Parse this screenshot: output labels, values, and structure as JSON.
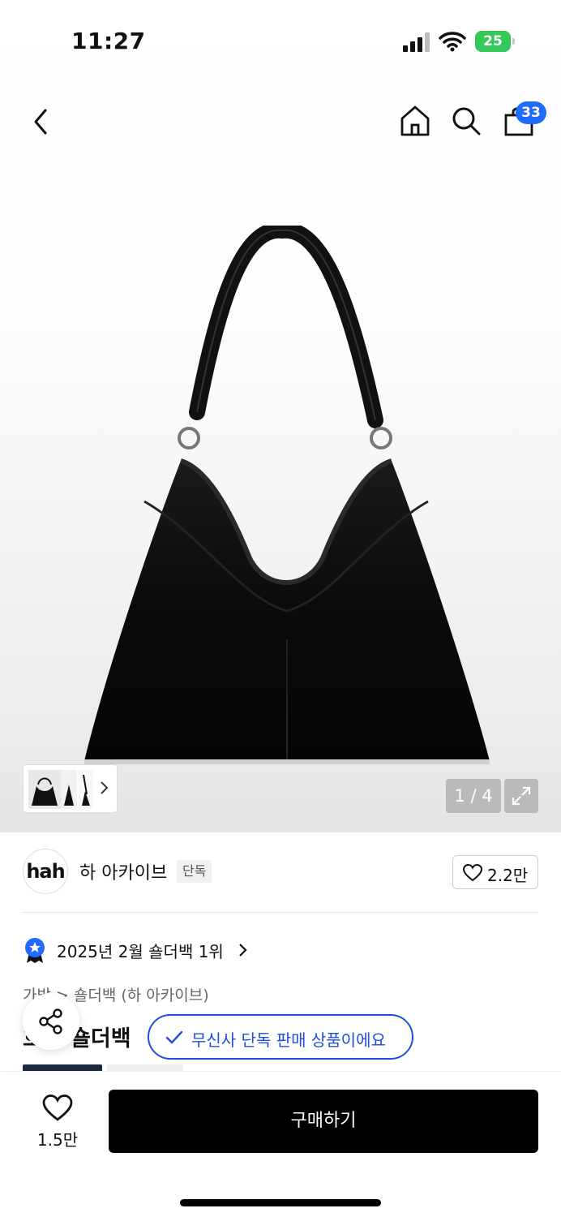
{
  "status_bar": {
    "time": "11:27",
    "battery": "25"
  },
  "header": {
    "cart_count": "33"
  },
  "gallery": {
    "page_indicator": "1 / 4"
  },
  "brand": {
    "logo_text": "hah",
    "name": "하 아카이브",
    "tag": "단독",
    "like_count": "2.2만"
  },
  "ranking": {
    "text": "2025년 2월 숄더백 1위"
  },
  "breadcrumb": {
    "category": "가방",
    "subcategory": "숄더백 (하 아카이브)"
  },
  "product": {
    "title_visible": "호버 숄더백"
  },
  "toast": {
    "text": "무신사 단독 판매 상품이에요"
  },
  "bottom_bar": {
    "wish_count": "1.5만",
    "buy_label": "구매하기"
  },
  "icons": [
    "back-icon",
    "home-icon",
    "search-icon",
    "cart-icon",
    "expand-icon",
    "heart-icon",
    "share-icon",
    "check-icon",
    "ranking-badge-icon",
    "chevron-right-icon"
  ]
}
